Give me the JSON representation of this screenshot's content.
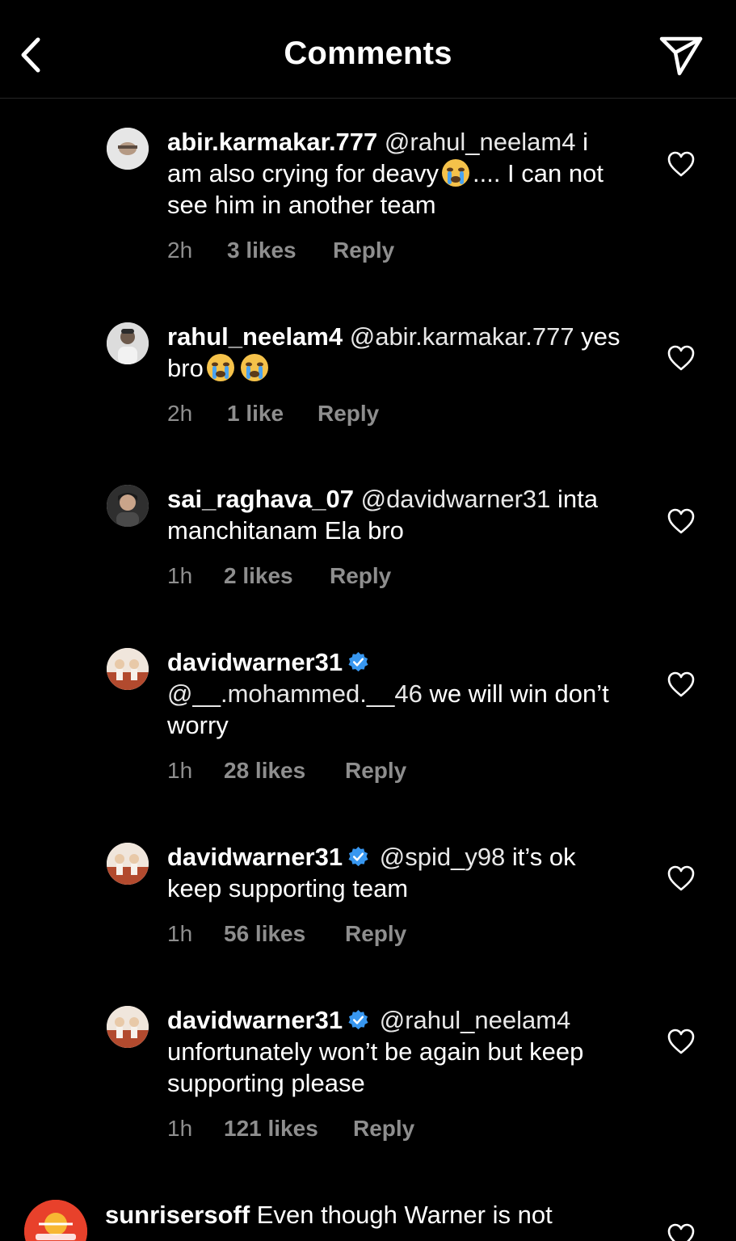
{
  "header": {
    "title": "Comments",
    "back_icon": "chevron-left-icon",
    "send_icon": "paper-plane-icon"
  },
  "comments": [
    {
      "user": "abir.karmakar.777",
      "verified": false,
      "mention": "@rahul_neelam4",
      "text_a": "i am also crying for deavy",
      "emoji": "crying-face",
      "text_b": ".... I can not see him in another team",
      "time": "2h",
      "likes": "3 likes",
      "reply": "Reply"
    },
    {
      "user": "rahul_neelam4",
      "verified": false,
      "mention": "@abir.karmakar.777",
      "text_a": "yes bro",
      "emoji": "crying-face",
      "text_b": "",
      "time": "2h",
      "likes": "1 like",
      "reply": "Reply"
    },
    {
      "user": "sai_raghava_07",
      "verified": false,
      "mention": "@davidwarner31",
      "text_a": "inta manchitanam Ela bro",
      "time": "1h",
      "likes": "2 likes",
      "reply": "Reply"
    },
    {
      "user": "davidwarner31",
      "verified": true,
      "mention": "@__.mohammed.__46",
      "text_a": "we will win don’t worry",
      "time": "1h",
      "likes": "28 likes",
      "reply": "Reply"
    },
    {
      "user": "davidwarner31",
      "verified": true,
      "mention": "@spid_y98",
      "text_a": "it’s ok keep supporting team",
      "time": "1h",
      "likes": "56 likes",
      "reply": "Reply"
    },
    {
      "user": "davidwarner31",
      "verified": true,
      "mention": "@rahul_neelam4",
      "text_a": "unfortunately won’t be again but keep supporting please",
      "time": "1h",
      "likes": "121 likes",
      "reply": "Reply"
    }
  ],
  "last_comment": {
    "user": "sunrisersoff",
    "text": "Even though Warner is not"
  },
  "colors": {
    "background": "#000000",
    "meta_text": "#8e8e8e",
    "verified": "#3897f0",
    "divider": "#262626"
  }
}
